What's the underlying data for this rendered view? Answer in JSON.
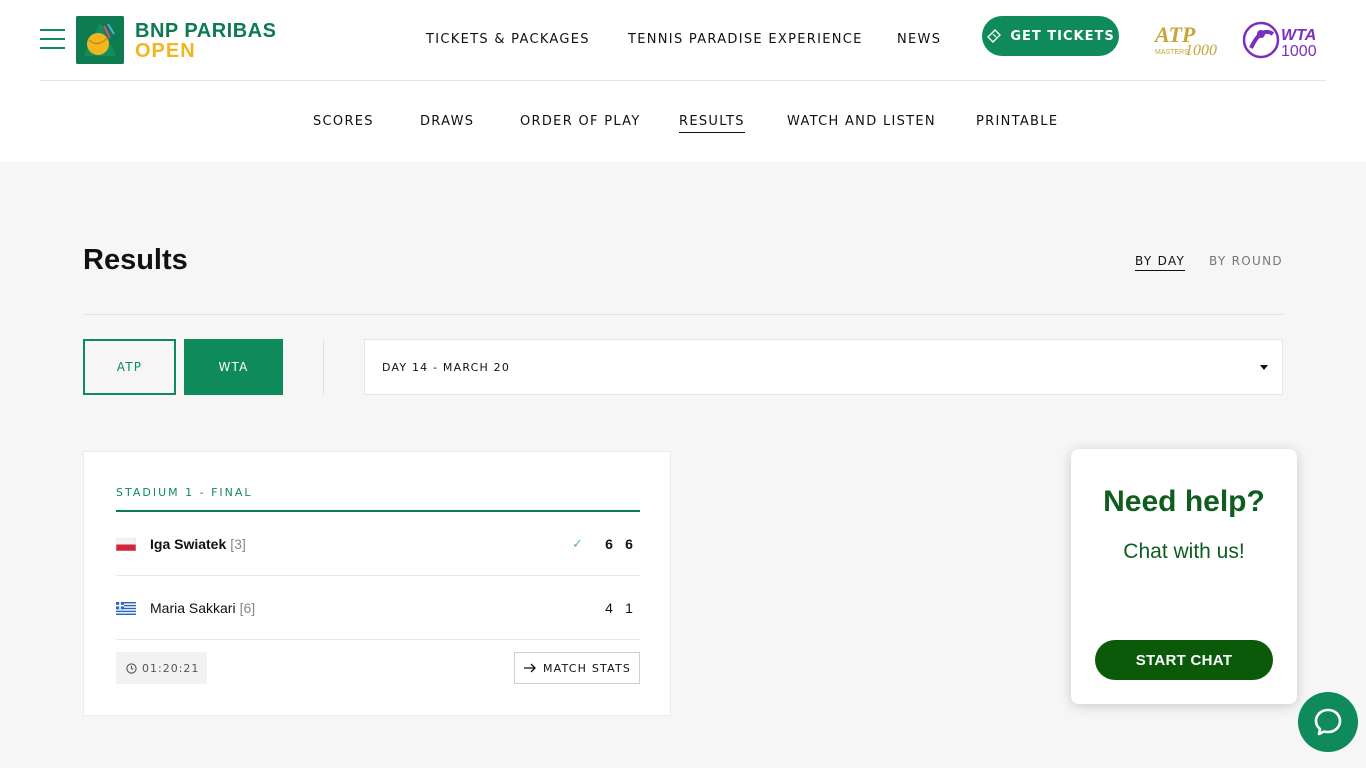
{
  "brand": {
    "line1": "BNP PARIBAS",
    "line2": "OPEN"
  },
  "topnav": {
    "tickets_packages": "TICKETS & PACKAGES",
    "tennis_paradise": "TENNIS PARADISE EXPERIENCE",
    "news": "NEWS",
    "get_tickets": "GET TICKETS"
  },
  "partners": {
    "atp_text": "ATP",
    "atp_sub": "MASTERS",
    "atp_num": "1000",
    "wta_text": "WTA",
    "wta_num": "1000"
  },
  "subnav": {
    "scores": "SCORES",
    "draws": "DRAWS",
    "order_of_play": "ORDER OF PLAY",
    "results": "RESULTS",
    "watch_listen": "WATCH AND LISTEN",
    "printable": "PRINTABLE",
    "active": "results"
  },
  "page": {
    "title": "Results",
    "by_day": "BY DAY",
    "by_round": "BY ROUND",
    "tour_atp": "ATP",
    "tour_wta": "WTA",
    "day_selected": "DAY 14 - MARCH 20"
  },
  "match": {
    "court": "STADIUM 1 - FINAL",
    "players": [
      {
        "name": "Iga Swiatek",
        "seed": "[3]",
        "country": "poland-flag-icon",
        "winner": true,
        "scores": [
          "6",
          "6"
        ]
      },
      {
        "name": "Maria Sakkari",
        "seed": "[6]",
        "country": "greece-flag-icon",
        "winner": false,
        "scores": [
          "4",
          "1"
        ]
      }
    ],
    "duration": "01:20:21",
    "stats_label": "MATCH STATS"
  },
  "help": {
    "title": "Need help?",
    "subtitle": "Chat with us!",
    "button": "START CHAT"
  },
  "colors": {
    "brand_green": "#0e8a5b",
    "brand_yellow": "#f3b61f",
    "help_green": "#0f5d1f",
    "chat_button": "#0a5a0a"
  }
}
